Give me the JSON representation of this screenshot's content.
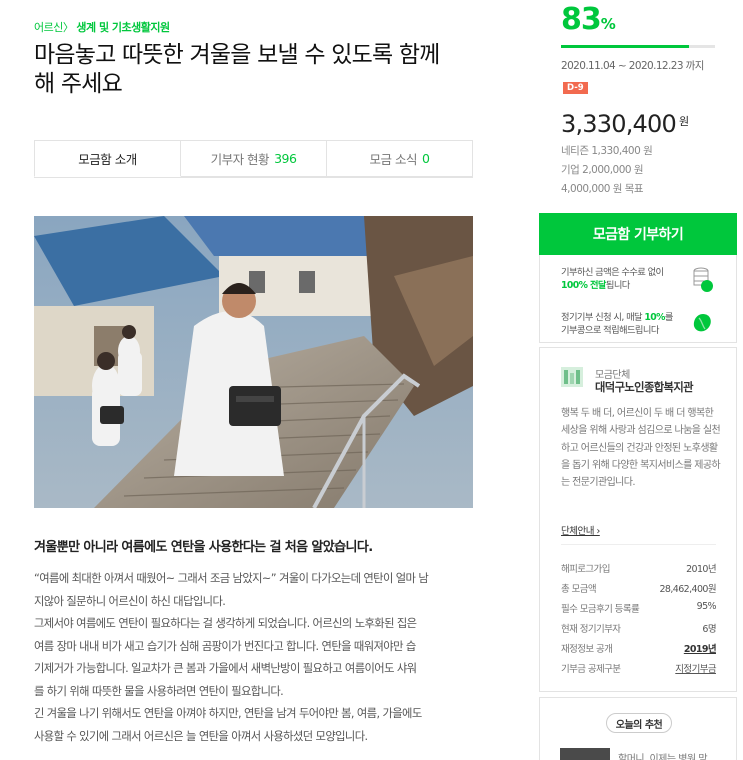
{
  "breadcrumb": {
    "category": "어르신",
    "separator": "〉",
    "subcategory": "생계 및 기초생활지원"
  },
  "title": "마음놓고 따뜻한 겨울을 보낼 수 있도록 함께 해 주세요",
  "tabs": [
    {
      "label": "모금함 소개",
      "count": "",
      "active": true
    },
    {
      "label": "기부자 현황",
      "count": "396",
      "active": false
    },
    {
      "label": "모금 소식",
      "count": "0",
      "active": false
    }
  ],
  "subheading": "겨울뿐만 아니라 여름에도 연탄을 사용한다는 걸 처음 알았습니다.",
  "body_lines": [
    "“여름에 최대한 아껴서 때웠어~ 그래서 조금 남았지~” 겨울이 다가오는데 연탄이 얼마 남",
    "지않아 질문하니 어르신이 하신 대답입니다.",
    "그제서야 여름에도 연탄이 필요하다는 걸 생각하게 되었습니다. 어르신의 노후화된 집은",
    "여름 장마 내내 비가 새고 습기가 심해 곰팡이가 번진다고 합니다. 연탄을 때워져야만 습",
    "기제거가 가능합니다. 일교차가 큰 봄과 가을에서 새벽난방이 필요하고 여름이어도 샤워",
    "를 하기 위해 따뜻한 물을 사용하려면 연탄이 필요합니다.",
    "긴 겨울을 나기 위해서도 연탄을 아껴야 하지만, 연탄을 남겨 두어야만 봄, 여름, 가을에도",
    "사용할 수 있기에 그래서 어르신은 늘 연탄을 아껴서 사용하셨던 모양입니다."
  ],
  "campaign": {
    "percent": "83",
    "percent_sign": "%",
    "progress": 0.83,
    "period": "2020.11.04 ~ 2020.12.23 까지",
    "dday": "D-9",
    "amount": "3,330,400",
    "amount_unit": "원",
    "breakdown": [
      "네티즌 1,330,400 원",
      "기업 2,000,000 원",
      "4,000,000 원 목표"
    ],
    "donate_label": "모금함 기부하기"
  },
  "info": {
    "line1a": "기부하신 금액은 수수료 없이",
    "line1b_green": "100% 전달",
    "line1b_rest": "됩니다",
    "line2a_pre": "정기기부 신청 시, 매달 ",
    "line2a_green": "10%",
    "line2a_post": "를",
    "line2b": "기부콩으로 적립해드립니다"
  },
  "org": {
    "label": "모금단체",
    "name": "대덕구노인종합복지관",
    "description": "행복 두 배 더, 어르신이 두 배 더 행복한 세상을 위해 사랑과 섬김으로 나눔을 실천하고 어르신들의 건강과 안정된 노후생활을 돕기 위해 다양한 복지서비스를 제공하는 전문기관입니다.",
    "more_label": "단체안내 ›",
    "stats": [
      {
        "label": "해피로그가입",
        "value": "2010년"
      },
      {
        "label": "총 모금액",
        "value": "28,462,400원"
      },
      {
        "label": "필수 모금후기 등록률",
        "value": "95%"
      },
      {
        "label": "현재 정기기부자",
        "value": "6명"
      },
      {
        "label": "재정정보 공개",
        "value": "2019년"
      },
      {
        "label": "기부금 공제구분",
        "value": "지정기부금"
      }
    ]
  },
  "recommend": {
    "title": "오늘의 추천",
    "item_text": "할머니, 이제는 병원 맘"
  },
  "colors": {
    "accent": "#00c73c",
    "dday": "#f26a4f"
  }
}
